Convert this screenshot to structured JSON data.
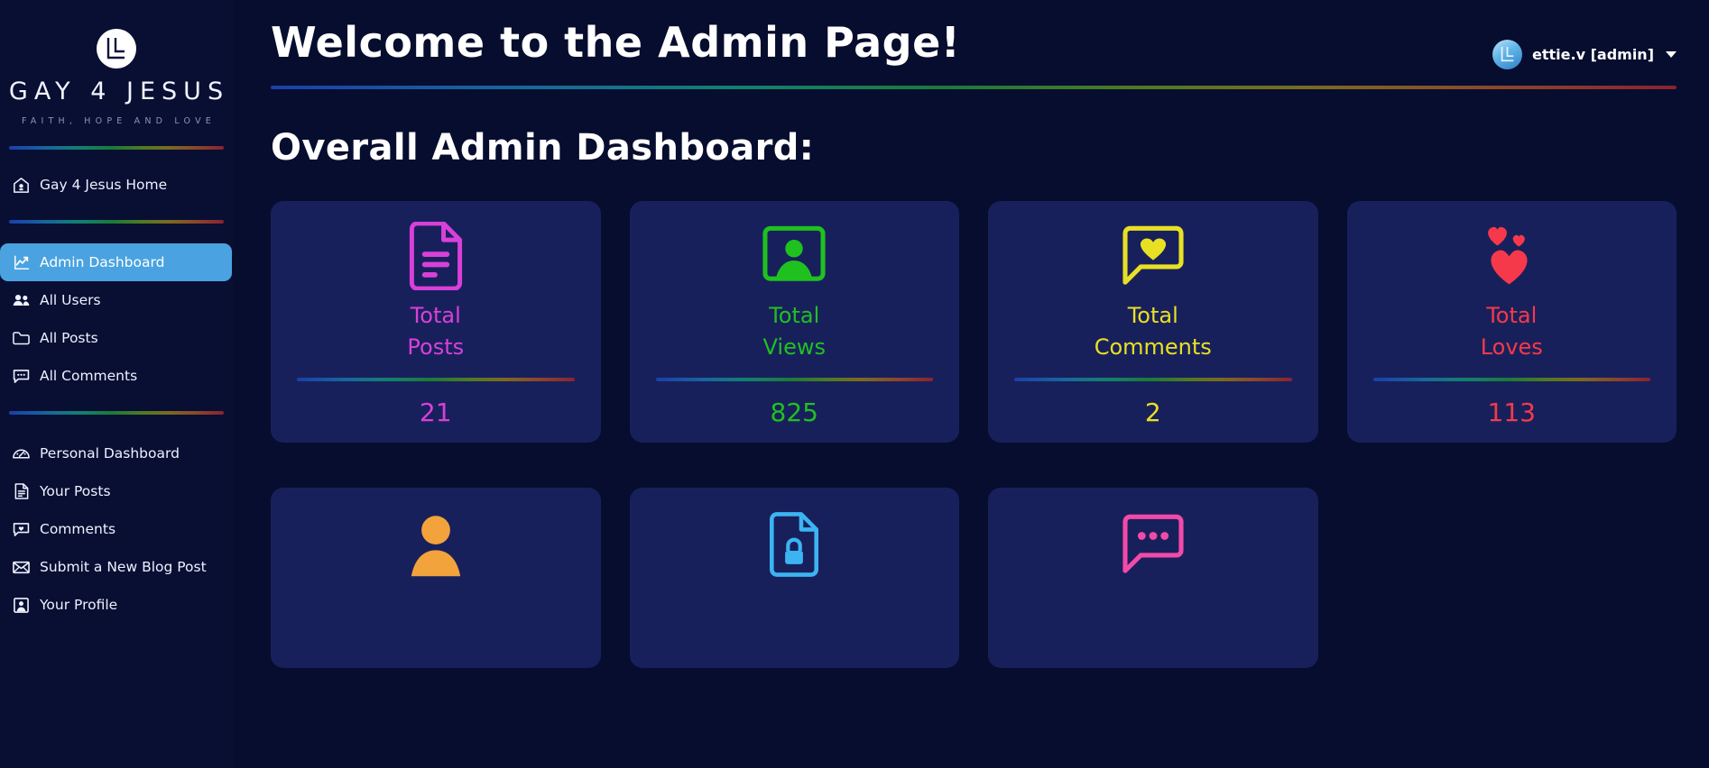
{
  "sidebar": {
    "brand": {
      "logo_icon": "gay4jesus-circle-l-logo",
      "title": "GAY 4 JESUS",
      "tagline": "FAITH, HOPE AND LOVE"
    },
    "items": [
      {
        "label": "Gay 4 Jesus Home",
        "icon": "home-icon",
        "active": false
      },
      {
        "label": "Admin Dashboard",
        "icon": "chart-line-up-icon",
        "active": true
      },
      {
        "label": "All Users",
        "icon": "users-icon",
        "active": false
      },
      {
        "label": "All Posts",
        "icon": "folder-icon",
        "active": false
      },
      {
        "label": "All Comments",
        "icon": "comment-dots-icon",
        "active": false
      },
      {
        "label": "Personal Dashboard",
        "icon": "gauge-icon",
        "active": false
      },
      {
        "label": "Your Posts",
        "icon": "file-lines-icon",
        "active": false
      },
      {
        "label": "Comments",
        "icon": "comment-heart-icon",
        "active": false
      },
      {
        "label": "Submit a New Blog Post",
        "icon": "envelope-icon",
        "active": false
      },
      {
        "label": "Your Profile",
        "icon": "user-square-icon",
        "active": false
      }
    ]
  },
  "header": {
    "title": "Welcome to the Admin Page!",
    "user": {
      "name": "ettie.v [admin]",
      "avatar_icon": "user-avatar-logo",
      "caret_icon": "chevron-down-icon"
    }
  },
  "main": {
    "section_title": "Overall Admin Dashboard:",
    "stat_cards": [
      {
        "label_line1": "Total",
        "label_line2": "Posts",
        "value": "21",
        "color": "#d940d9",
        "icon": "document-lines-icon"
      },
      {
        "label_line1": "Total",
        "label_line2": "Views",
        "value": "825",
        "color": "#1fc11f",
        "icon": "user-screen-icon"
      },
      {
        "label_line1": "Total",
        "label_line2": "Comments",
        "value": "2",
        "color": "#e8e023",
        "icon": "comment-heart-icon"
      },
      {
        "label_line1": "Total",
        "label_line2": "Loves",
        "value": "113",
        "color": "#f6394a",
        "icon": "hearts-icon"
      }
    ],
    "stat_cards_row2": [
      {
        "icon": "person-icon",
        "color": "#f2a33c"
      },
      {
        "icon": "locked-file-icon",
        "color": "#3cb4f2"
      },
      {
        "icon": "comment-dots-icon",
        "color": "#f24aa8"
      }
    ]
  },
  "colors": {
    "page_bg": "#070d2e",
    "sidebar_bg": "#080f33",
    "card_bg": "#18205c",
    "active_nav": "#4aa3e0",
    "text": "#ffffff"
  }
}
